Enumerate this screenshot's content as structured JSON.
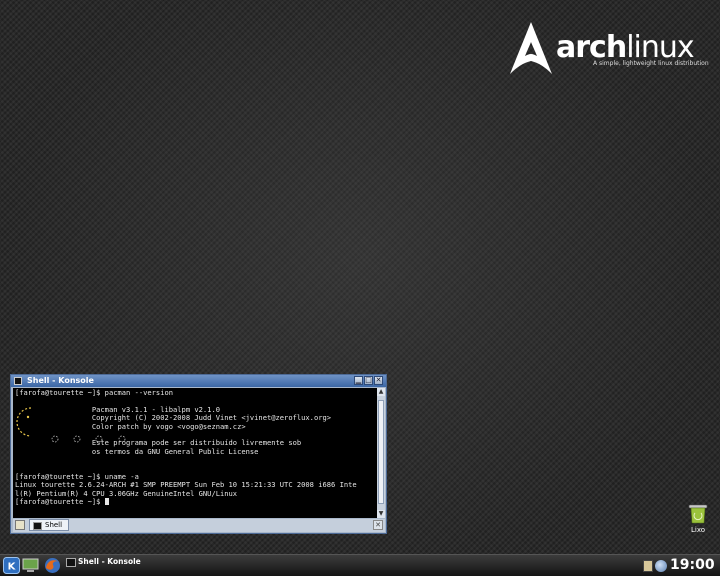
{
  "desktop": {
    "logo": {
      "brand_bold": "arch",
      "brand_light": "linux",
      "tagline": "A simple, lightweight linux distribution"
    },
    "trash": {
      "label": "Lixo",
      "icon": "trash-can-icon"
    }
  },
  "konsole": {
    "title": "Shell - Konsole",
    "buttons": {
      "minimize": "▁",
      "maximize": "□",
      "close": "✕"
    },
    "terminal_lines": [
      "[farofa@tourette ~]$ pacman --version",
      "",
      "                  Pacman v3.1.1 - libalpm v2.1.0",
      "                  Copyright (C) 2002-2008 Judd Vinet <jvinet@zeroflux.org>",
      "                  Color patch by vogo <vogo@seznam.cz>",
      "",
      "                  Este programa pode ser distribuído livremente sob",
      "                  os termos da GNU General Public License",
      "",
      "",
      "[farofa@tourette ~]$ uname -a",
      "Linux tourette 2.6.24-ARCH #1 SMP PREEMPT Sun Feb 10 15:21:33 UTC 2008 i686 Inte",
      "l(R) Pentium(R) 4 CPU 3.06GHz GenuineIntel GNU/Linux",
      "[farofa@tourette ~]$ "
    ],
    "tab": {
      "label": "Shell"
    }
  },
  "taskbar": {
    "task_label": "Shell - Konsole",
    "clock": "19:00",
    "icons": [
      "kde-menu-icon",
      "desktop-icon",
      "firefox-icon",
      "clipboard-icon",
      "network-icon"
    ]
  },
  "colors": {
    "titlebar_top": "#6f93c6",
    "titlebar_bottom": "#3b66a5",
    "terminal_bg": "#000000",
    "pacman_yellow": "#e8c64a"
  }
}
